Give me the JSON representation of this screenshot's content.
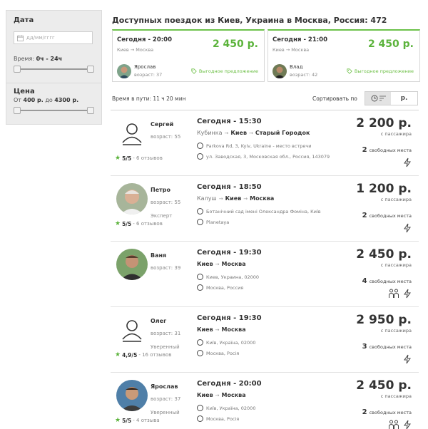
{
  "filter": {
    "date_label": "Дата",
    "date_placeholder": "дд/мм/гггг",
    "time_label": "Время:",
    "time_range": "0ч - 24ч",
    "price_label": "Цена",
    "price_from_prefix": "От",
    "price_from": "400 р.",
    "price_to_prefix": "до",
    "price_to": "4300 р."
  },
  "header": {
    "title": "Доступных поездок из Киев, Украина в Москва, Россия: 472"
  },
  "top_offers": [
    {
      "time": "Сегодня - 20:00",
      "route": "Киев → Москва",
      "price": "2 450 р.",
      "driver": "Ярослав",
      "age": "возраст: 37",
      "deal": "Выгодное предложение"
    },
    {
      "time": "Сегодня - 21:00",
      "route": "Киев → Москва",
      "price": "2 450 р.",
      "driver": "Влад",
      "age": "возраст: 42",
      "deal": "Выгодное предложение"
    }
  ],
  "sort": {
    "travel_time": "Время в пути: 11 ч 20 мин",
    "label": "Сортировать по",
    "price_option": "р."
  },
  "trips": [
    {
      "name": "Сергей",
      "age": "возраст: 55",
      "badge": "",
      "rating": "5/5",
      "reviews": "- 6 отзывов",
      "time": "Сегодня - 15:30",
      "from_pre": "Кубинка",
      "from": "Киев",
      "to": "Старый Городок",
      "stop1": "Parkova Rd, 3, Kyiv, Ukraine - место встречи",
      "stop2": "ул. Заводская, 3, Московская обл., Россия, 143079",
      "price": "2 200 р.",
      "per": "с пассажира",
      "seats_num": "2",
      "seats_text": "свободных места"
    },
    {
      "name": "Петро",
      "age": "возраст: 55",
      "badge": "Эксперт",
      "rating": "5/5",
      "reviews": "- 6 отзывов",
      "time": "Сегодня - 18:50",
      "from_pre": "Калуш",
      "from": "Киев",
      "to": "Москва",
      "stop1": "Ботанічний сад імені Олександра Фоміна, Київ",
      "stop2": "Planetaya",
      "price": "1 200 р.",
      "per": "с пассажира",
      "seats_num": "2",
      "seats_text": "свободных места"
    },
    {
      "name": "Ваня",
      "age": "возраст: 39",
      "badge": "",
      "rating": "",
      "reviews": "",
      "time": "Сегодня - 19:30",
      "from_pre": "",
      "from": "Киев",
      "to": "Москва",
      "stop1": "Киев, Украина, 02000",
      "stop2": "Москва, Россия",
      "price": "2 450 р.",
      "per": "с пассажира",
      "seats_num": "4",
      "seats_text": "свободных места"
    },
    {
      "name": "Олег",
      "age": "возраст: 31",
      "badge": "Уверенный",
      "rating": "4,9/5",
      "reviews": "- 16 отзывов",
      "time": "Сегодня - 19:30",
      "from_pre": "",
      "from": "Киев",
      "to": "Москва",
      "stop1": "Київ, Україна, 02000",
      "stop2": "Москва, Росія",
      "price": "2 950 р.",
      "per": "с пассажира",
      "seats_num": "3",
      "seats_text": "свободных места"
    },
    {
      "name": "Ярослав",
      "age": "возраст: 37",
      "badge": "Уверенный",
      "rating": "5/5",
      "reviews": "- 4 отзыва",
      "time": "Сегодня - 20:00",
      "from_pre": "",
      "from": "Киев",
      "to": "Москва",
      "stop1": "Київ, Україна, 02000",
      "stop2": "Москва, Росія",
      "price": "2 450 р.",
      "per": "с пассажира",
      "seats_num": "2",
      "seats_text": "свободных места"
    }
  ],
  "colors": {
    "accent": "#6cc24a",
    "price_green": "#5bb33b",
    "star": "#5bb33b"
  }
}
